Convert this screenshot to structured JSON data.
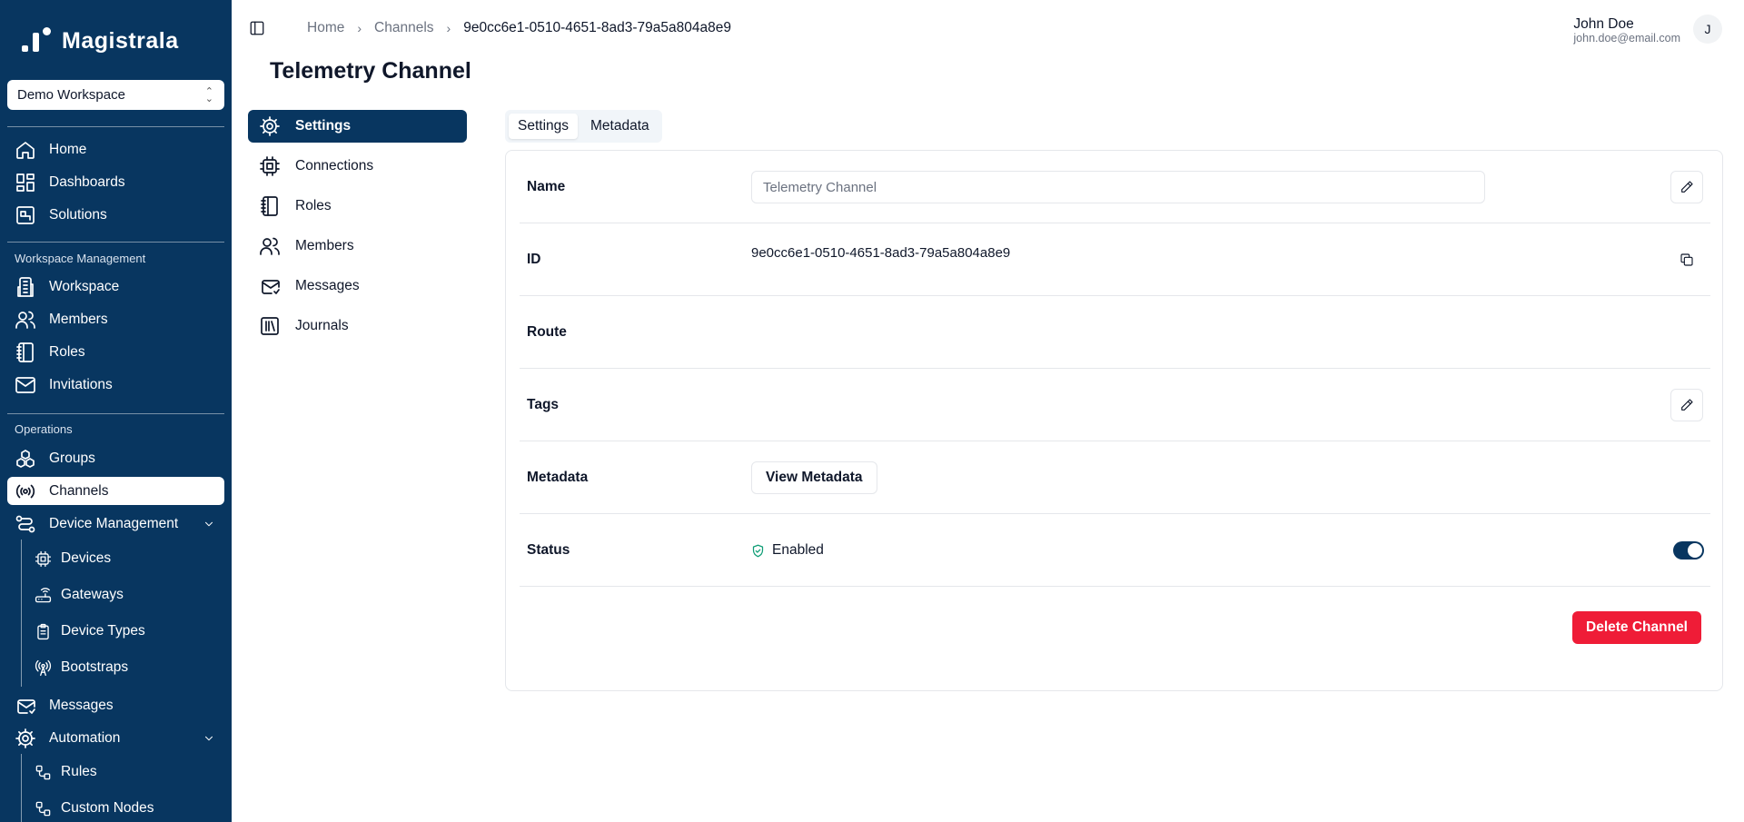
{
  "app": {
    "name": "Magistrala"
  },
  "workspace": {
    "selected": "Demo Workspace"
  },
  "sidebar": {
    "main": [
      {
        "label": "Home",
        "icon": "home-icon"
      },
      {
        "label": "Dashboards",
        "icon": "dashboard-icon"
      },
      {
        "label": "Solutions",
        "icon": "solutions-icon"
      }
    ],
    "workspace_section": "Workspace Management",
    "workspace_items": [
      {
        "label": "Workspace",
        "icon": "building-icon"
      },
      {
        "label": "Members",
        "icon": "users-icon"
      },
      {
        "label": "Roles",
        "icon": "notebook-icon"
      },
      {
        "label": "Invitations",
        "icon": "mail-icon"
      }
    ],
    "operations_section": "Operations",
    "operations_items": [
      {
        "label": "Groups",
        "icon": "groups-icon"
      },
      {
        "label": "Channels",
        "icon": "broadcast-icon",
        "active": true
      },
      {
        "label": "Device Management",
        "icon": "route-icon",
        "expanded": true
      },
      {
        "label": "Messages",
        "icon": "mail-open-icon"
      },
      {
        "label": "Automation",
        "icon": "cog-icon",
        "expanded": true
      }
    ],
    "device_management_items": [
      {
        "label": "Devices",
        "icon": "cpu-icon"
      },
      {
        "label": "Gateways",
        "icon": "router-icon"
      },
      {
        "label": "Device Types",
        "icon": "clipboard-icon"
      },
      {
        "label": "Bootstraps",
        "icon": "radio-tower-icon"
      }
    ],
    "automation_items": [
      {
        "label": "Rules",
        "icon": "workflow-icon"
      },
      {
        "label": "Custom Nodes",
        "icon": "workflow-icon"
      }
    ]
  },
  "breadcrumb": {
    "items": [
      "Home",
      "Channels",
      "9e0cc6e1-0510-4651-8ad3-79a5a804a8e9"
    ],
    "separator": "›"
  },
  "user": {
    "name": "John Doe",
    "email": "john.doe@email.com",
    "initial": "J"
  },
  "page": {
    "title": "Telemetry Channel"
  },
  "entity_menu": [
    {
      "label": "Settings",
      "icon": "cog-icon",
      "active": true
    },
    {
      "label": "Connections",
      "icon": "cpu-icon"
    },
    {
      "label": "Roles",
      "icon": "notebook-icon"
    },
    {
      "label": "Members",
      "icon": "users-icon"
    },
    {
      "label": "Messages",
      "icon": "mail-open-icon"
    },
    {
      "label": "Journals",
      "icon": "library-icon"
    }
  ],
  "tabs": [
    {
      "label": "Settings",
      "active": true
    },
    {
      "label": "Metadata",
      "active": false
    }
  ],
  "settings": {
    "name_label": "Name",
    "name_value": "Telemetry Channel",
    "id_label": "ID",
    "id_value": "9e0cc6e1-0510-4651-8ad3-79a5a804a8e9",
    "route_label": "Route",
    "route_value": "",
    "tags_label": "Tags",
    "metadata_label": "Metadata",
    "view_metadata": "View Metadata",
    "status_label": "Status",
    "status_value": "Enabled",
    "status_enabled": true,
    "delete_button": "Delete Channel"
  },
  "colors": {
    "sidebar_bg": "#083660",
    "primary": "#083660",
    "danger": "#ef1c37",
    "status_ok": "#0f9d76"
  }
}
